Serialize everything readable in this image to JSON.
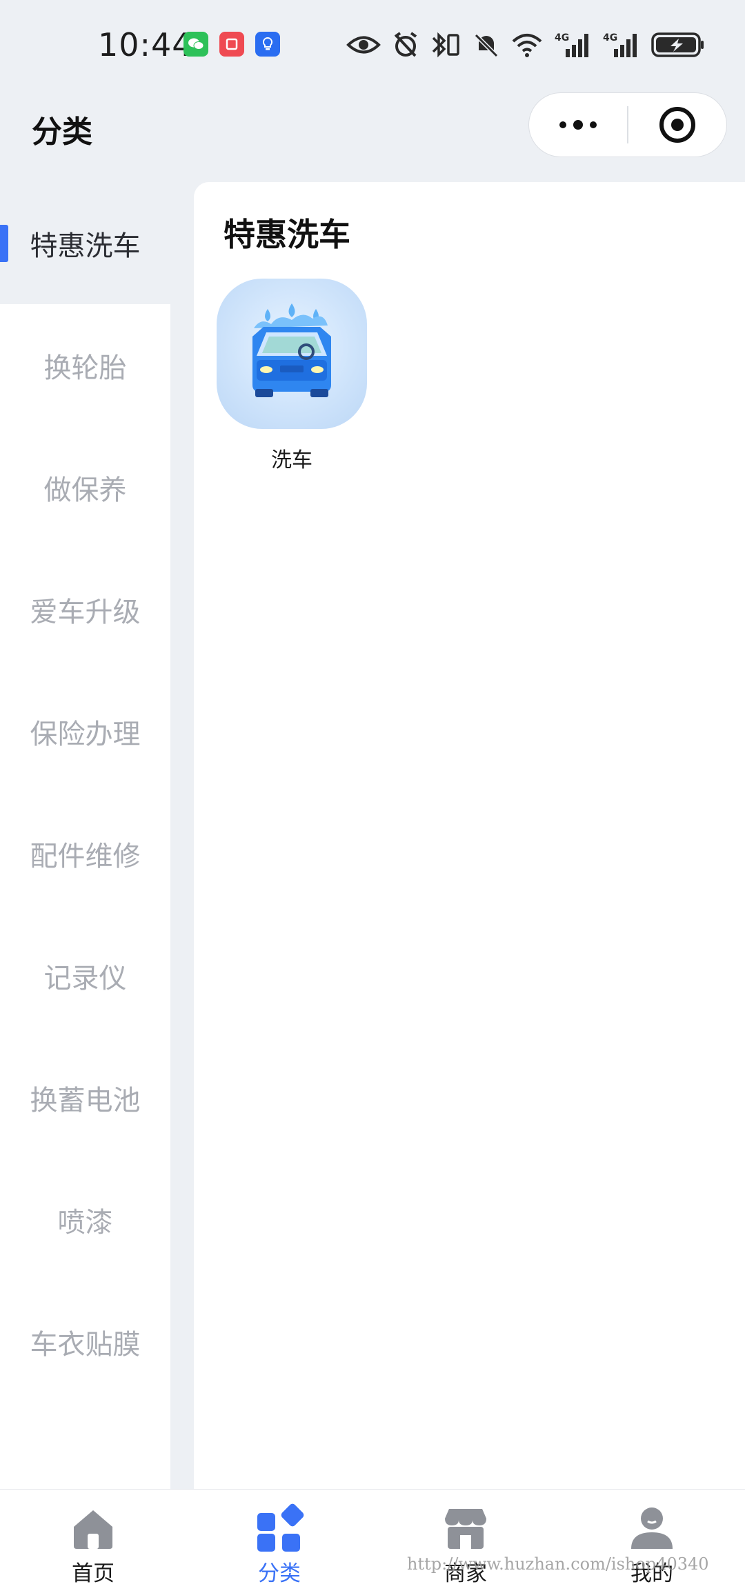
{
  "status_bar": {
    "time": "10:44",
    "network_1": "4G",
    "network_2": "4G"
  },
  "header": {
    "title": "分类",
    "more_icon": "more-dots-icon",
    "close_icon": "target-circle-icon"
  },
  "sidebar": {
    "active_index": 0,
    "accent_color": "#3a72f6",
    "items": [
      {
        "label": "特惠洗车"
      },
      {
        "label": "换轮胎"
      },
      {
        "label": "做保养"
      },
      {
        "label": "爱车升级"
      },
      {
        "label": "保险办理"
      },
      {
        "label": "配件维修"
      },
      {
        "label": "记录仪"
      },
      {
        "label": "换蓄电池"
      },
      {
        "label": "喷漆"
      },
      {
        "label": "车衣贴膜"
      }
    ]
  },
  "content": {
    "section_title": "特惠洗车",
    "items": [
      {
        "label": "洗车",
        "icon": "car-wash-icon"
      }
    ]
  },
  "tabbar": {
    "active_index": 1,
    "tabs": [
      {
        "label": "首页",
        "icon": "home-icon"
      },
      {
        "label": "分类",
        "icon": "category-icon"
      },
      {
        "label": "商家",
        "icon": "store-icon"
      },
      {
        "label": "我的",
        "icon": "user-icon"
      }
    ]
  },
  "watermark": "http://www.huzhan.com/ishop40340"
}
